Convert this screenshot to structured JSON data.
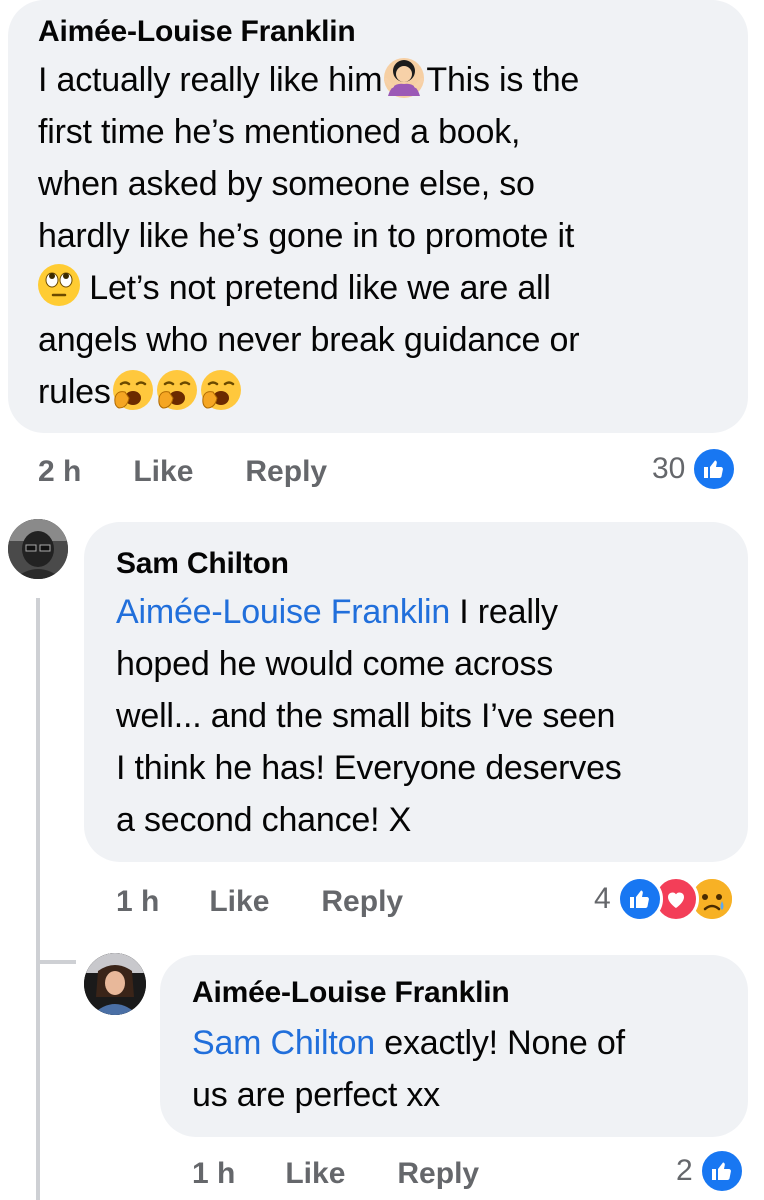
{
  "comments": [
    {
      "author": "Aimée-Louise Franklin",
      "line1_a": "I actually really like him",
      "line1_b": "This is the",
      "line2": "first time he’s mentioned a book,",
      "line3": "when asked by someone else, so",
      "line4": "hardly like he’s gone in to promote it",
      "line5": " Let’s not pretend like we are all",
      "line6": "angels who never break guidance or",
      "line7": "rules",
      "time": "2 h",
      "like": "Like",
      "reply": "Reply",
      "reaction_count": "30",
      "emojis": [
        "person-shrugging-emoji",
        "face-with-rolling-eyes-emoji",
        "yawning-face-emoji"
      ]
    },
    {
      "author": "Sam Chilton",
      "mention": "Aimée-Louise Franklin",
      "line1": " I really",
      "line2": "hoped he would come across",
      "line3": "well... and the small bits I’ve seen",
      "line4": "I think he has! Everyone deserves",
      "line5": "a second chance! X",
      "time": "1 h",
      "like": "Like",
      "reply": "Reply",
      "reaction_count": "4",
      "reactions": [
        "like",
        "love",
        "sad"
      ]
    },
    {
      "author": "Aimée-Louise Franklin",
      "mention": "Sam Chilton",
      "line1": " exactly! None of",
      "line2": "us are perfect xx",
      "time": "1 h",
      "like": "Like",
      "reply": "Reply",
      "reaction_count": "2",
      "reactions": [
        "like"
      ]
    }
  ],
  "colors": {
    "bubble": "#f0f2f5",
    "mention": "#216fdb",
    "meta": "#65676b",
    "like_blue": "#1877f2",
    "love_red": "#f33e58"
  }
}
